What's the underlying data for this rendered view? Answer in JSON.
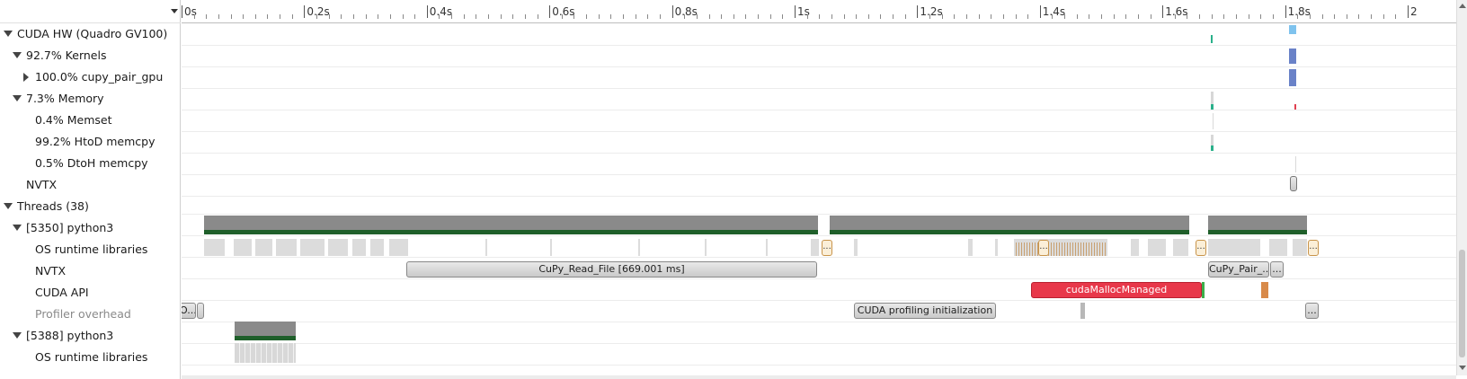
{
  "ruler": {
    "ticks": [
      {
        "label": "0s",
        "value": 0
      },
      {
        "label": "0.2s",
        "value": 0.2
      },
      {
        "label": "0.4s",
        "value": 0.4
      },
      {
        "label": "0.6s",
        "value": 0.6
      },
      {
        "label": "0.8s",
        "value": 0.8
      },
      {
        "label": "1s",
        "value": 1.0
      },
      {
        "label": "1.2s",
        "value": 1.2
      },
      {
        "label": "1.4s",
        "value": 1.4
      },
      {
        "label": "1.6s",
        "value": 1.6
      },
      {
        "label": "1.8s",
        "value": 1.8
      },
      {
        "label": "2",
        "value": 2.0
      }
    ]
  },
  "tree": {
    "rows": [
      {
        "label": "CUDA HW (Quadro GV100)",
        "toggle": "down",
        "depth": 0,
        "muted": false
      },
      {
        "label": "92.7% Kernels",
        "toggle": "down",
        "depth": 1,
        "muted": false
      },
      {
        "label": "100.0% cupy_pair_gpu",
        "toggle": "right",
        "depth": 2,
        "muted": false
      },
      {
        "label": "7.3% Memory",
        "toggle": "down",
        "depth": 1,
        "muted": false
      },
      {
        "label": "0.4% Memset",
        "toggle": "",
        "depth": 2,
        "muted": false
      },
      {
        "label": "99.2% HtoD memcpy",
        "toggle": "",
        "depth": 2,
        "muted": false
      },
      {
        "label": "0.5% DtoH memcpy",
        "toggle": "",
        "depth": 2,
        "muted": false
      },
      {
        "label": "NVTX",
        "toggle": "",
        "depth": 1,
        "muted": false
      },
      {
        "label": "Threads (38)",
        "toggle": "down",
        "depth": 0,
        "muted": false
      },
      {
        "label": "[5350] python3",
        "toggle": "down",
        "depth": 1,
        "muted": false
      },
      {
        "label": "OS runtime libraries",
        "toggle": "",
        "depth": 2,
        "muted": false
      },
      {
        "label": "NVTX",
        "toggle": "",
        "depth": 2,
        "muted": false
      },
      {
        "label": "CUDA API",
        "toggle": "",
        "depth": 2,
        "muted": false
      },
      {
        "label": "Profiler overhead",
        "toggle": "",
        "depth": 2,
        "muted": true
      },
      {
        "label": "[5388] python3",
        "toggle": "down",
        "depth": 1,
        "muted": false
      },
      {
        "label": "OS runtime libraries",
        "toggle": "",
        "depth": 2,
        "muted": false
      }
    ]
  },
  "timeline": {
    "nvtx_read": "CuPy_Read_File [669.001 ms]",
    "nvtx_pair": "CuPy_Pair_...",
    "nvtx_more": "...",
    "cuda_api_main": "cudaMallocManaged",
    "overhead_first": "O...",
    "overhead_init": "CUDA profiling initialization",
    "overhead_end": "...",
    "osrt_ellipsis": "..."
  },
  "colors": {
    "kernel": "#6a82c8",
    "kernel_light": "#7fc3ee",
    "memcpy_htod": "#2ab08a",
    "memcpy_dtoh": "#e04050",
    "thread_busy": "#8a8a8a",
    "thread_green": "#1f5f2a",
    "osrt": "#d6d6d6",
    "cuda_api": "#e8384a"
  }
}
